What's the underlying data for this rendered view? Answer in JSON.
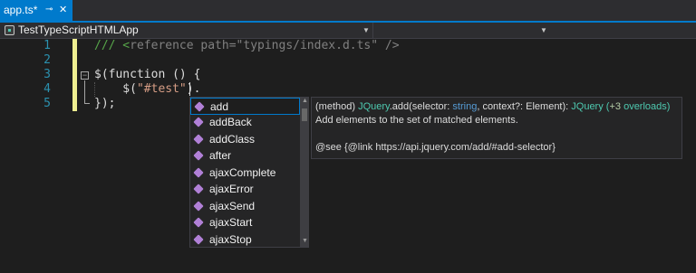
{
  "tab": {
    "title": "app.ts*",
    "pin_glyph": "⊸",
    "close_glyph": "✕"
  },
  "navbar": {
    "project_name": "TestTypeScriptHTMLApp",
    "method_name": ""
  },
  "editor": {
    "line_numbers": [
      "1",
      "2",
      "3",
      "4",
      "5"
    ],
    "lines": {
      "l1_comment": "/// <",
      "l1_ref": "reference path=\"typings/index.d.ts\" />",
      "l3_code": "$(function () {",
      "l4_pre": "    $(",
      "l4_string": "\"#test\"",
      "l4_post": ").",
      "l5_code": "});"
    }
  },
  "completion": {
    "items": [
      {
        "label": "add",
        "icon": "method-icon",
        "selected": true
      },
      {
        "label": "addBack",
        "icon": "method-icon"
      },
      {
        "label": "addClass",
        "icon": "method-icon"
      },
      {
        "label": "after",
        "icon": "method-icon"
      },
      {
        "label": "ajaxComplete",
        "icon": "method-icon"
      },
      {
        "label": "ajaxError",
        "icon": "method-icon"
      },
      {
        "label": "ajaxSend",
        "icon": "method-icon"
      },
      {
        "label": "ajaxStart",
        "icon": "method-icon"
      },
      {
        "label": "ajaxStop",
        "icon": "method-icon"
      }
    ],
    "typed": "add"
  },
  "tooltip": {
    "sig_kind": "(method) ",
    "sig_owner": "JQuery",
    "sig_name": ".add(selector: ",
    "sig_type1": "string",
    "sig_mid": ", context?: Element): ",
    "sig_ret": "JQuery",
    "sig_open": " (",
    "sig_overload_count": "+3",
    "sig_overload_text": " overloads)",
    "description": "Add elements to the set of matched elements.",
    "see": "@see {@link https://api.jquery.com/add/#add-selector}"
  },
  "colors": {
    "accent": "#007acc",
    "method_icon": "#b180d7",
    "type": "#4ec9b0",
    "keyword": "#569cd6",
    "line_number": "#2b91af",
    "comment": "#57a64a",
    "string": "#d69d85"
  }
}
